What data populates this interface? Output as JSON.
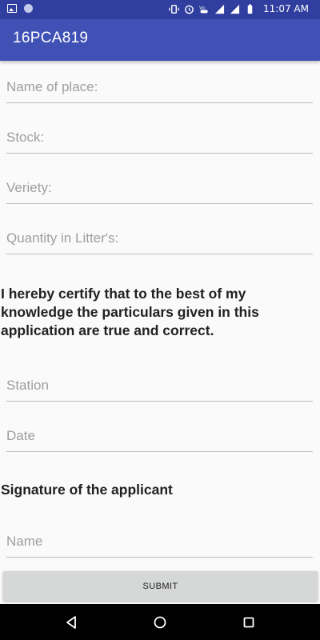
{
  "status_bar": {
    "left_icons": [
      "image-icon",
      "circle-dot-icon"
    ],
    "right_icons": [
      "vibrate-icon",
      "alarm-icon",
      "volte-icon",
      "signal-4g-icon",
      "signal-icon",
      "battery-icon"
    ],
    "time": "11:07 AM"
  },
  "app_bar": {
    "title": "16PCA819"
  },
  "form": {
    "name_of_place_placeholder": "Name of place:",
    "stock_placeholder": "Stock:",
    "variety_placeholder": "Veriety:",
    "quantity_placeholder": "Quantity in Litter's:",
    "certification": "I hereby certify that to the best of my knowledge the particulars given in this application are true and correct.",
    "station_placeholder": "Station",
    "date_placeholder": "Date",
    "signature_label": "Signature of the applicant",
    "name_placeholder": "Name",
    "submit_label": "SUBMIT"
  },
  "nav_bar": {
    "buttons": [
      "back-icon",
      "home-icon",
      "recents-icon"
    ]
  },
  "colors": {
    "primary": "#3f51b5",
    "primary_dark": "#303f9f",
    "background": "#fafafa",
    "button": "#d6d7d7"
  }
}
